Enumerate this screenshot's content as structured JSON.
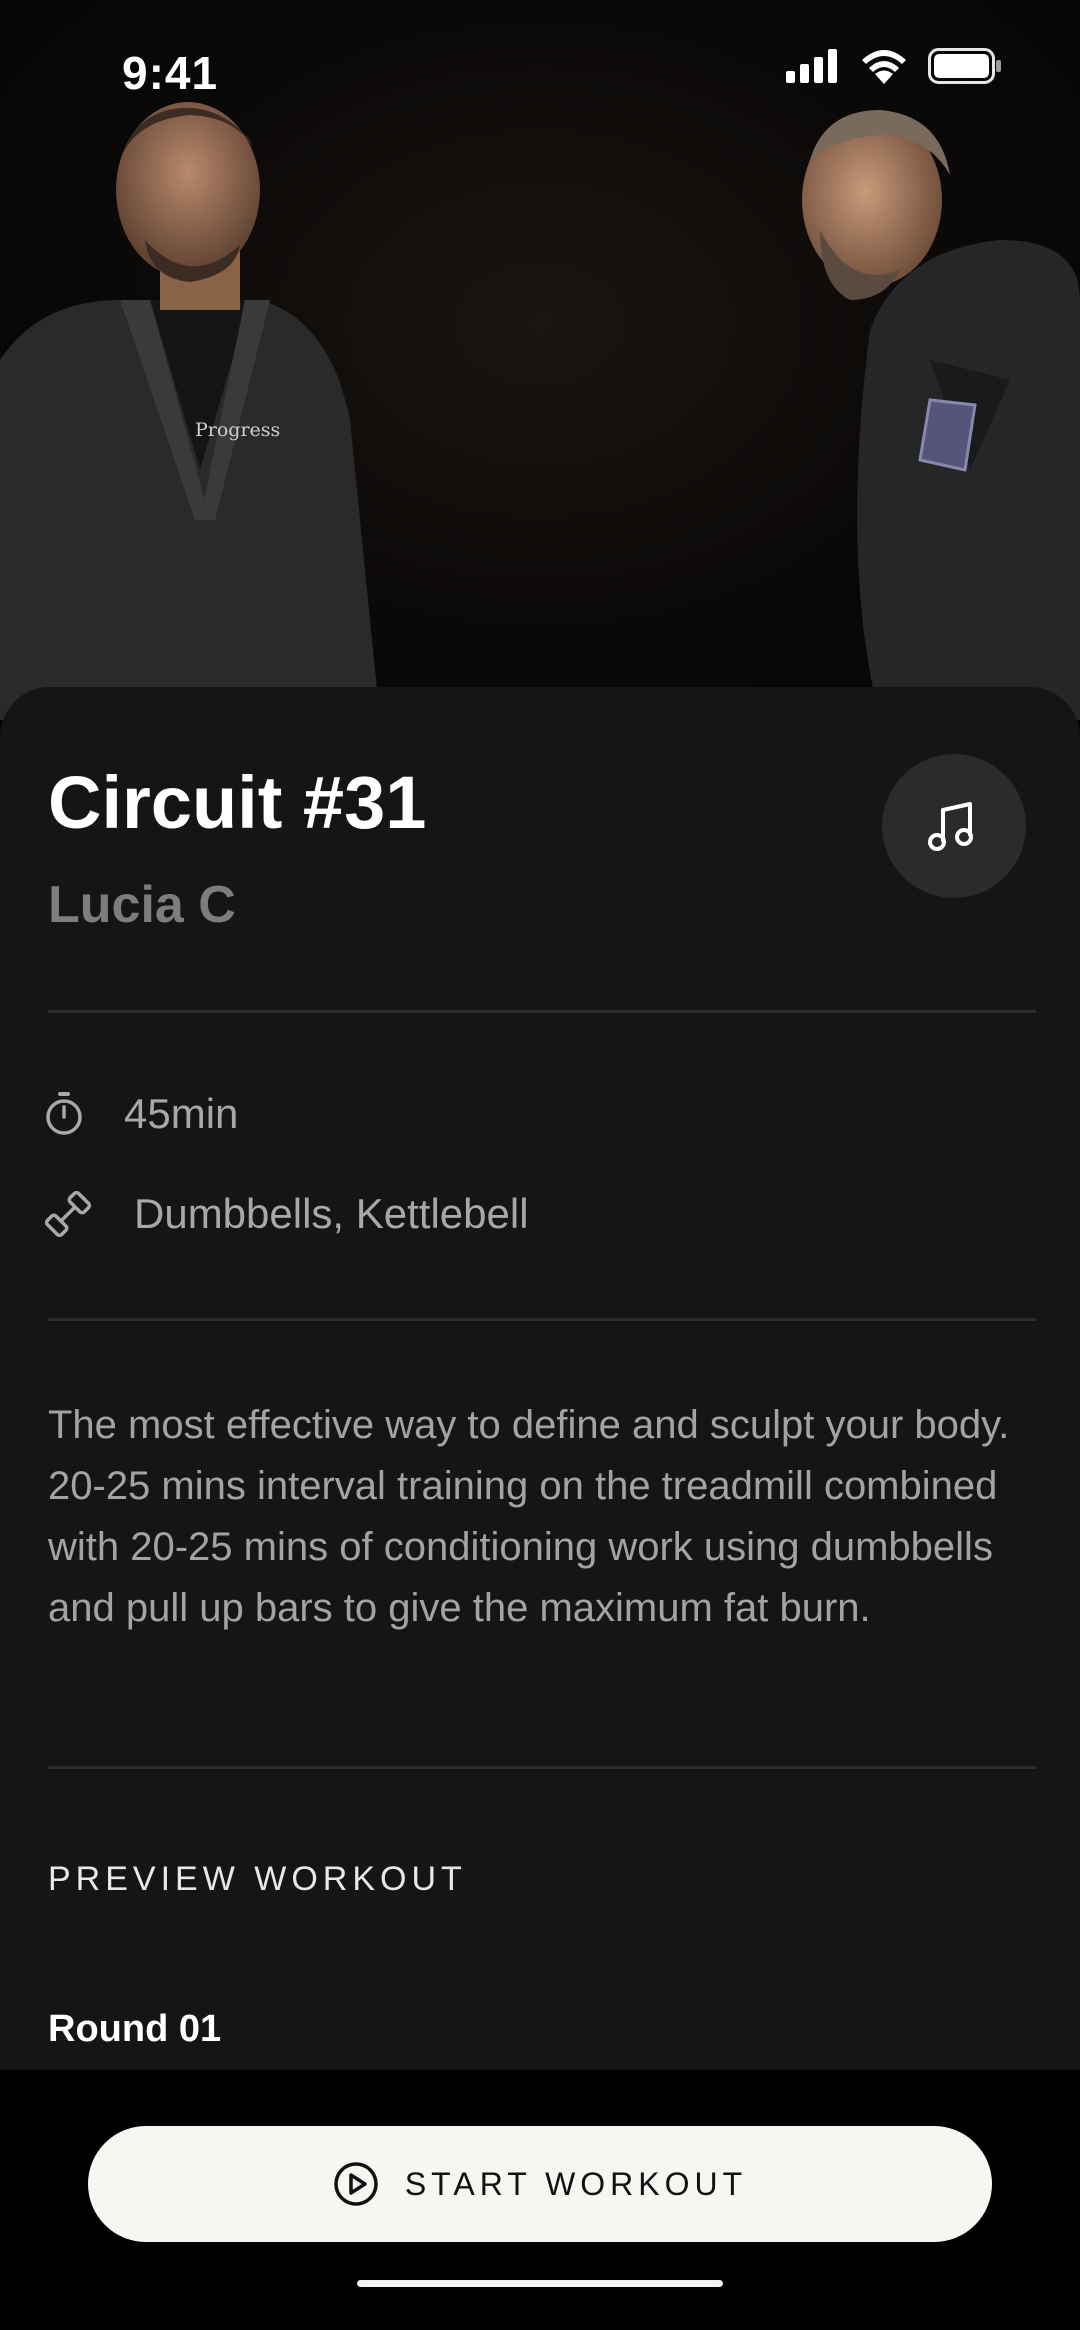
{
  "status_bar": {
    "time": "9:41",
    "icons": [
      "cellular-signal-icon",
      "wifi-icon",
      "battery-icon"
    ]
  },
  "hero": {
    "image": "two-martial-artists-in-gi-photo",
    "shirt_text": "Progress"
  },
  "workout": {
    "title": "Circuit #31",
    "trainer": "Lucia C",
    "music_icon": "music-note-icon",
    "duration_icon": "stopwatch-icon",
    "duration": "45min",
    "equipment_icon": "dumbbell-icon",
    "equipment": "Dumbbells, Kettlebell",
    "description": "The most effective way to define and sculpt your body. 20-25 mins interval training on the treadmill combined with 20-25 mins of conditioning work using dumbbells and pull up bars to give the maximum fat burn."
  },
  "preview": {
    "heading": "PREVIEW WORKOUT",
    "round": "Round 01"
  },
  "cta": {
    "icon": "play-circle-icon",
    "label": "START WORKOUT"
  },
  "colors": {
    "card_bg": "#151515",
    "muted_text": "#a3a3a3",
    "button_bg": "#f7f6f3",
    "music_button_bg": "#2b2b2b"
  }
}
